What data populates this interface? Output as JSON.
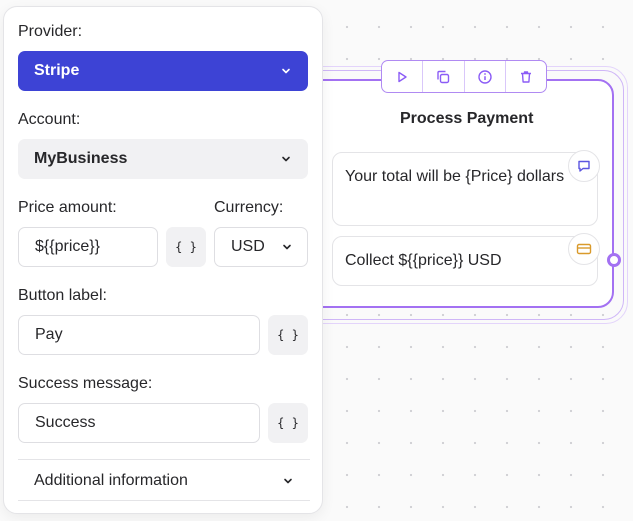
{
  "panel": {
    "provider_label": "Provider:",
    "provider_value": "Stripe",
    "account_label": "Account:",
    "account_value": "MyBusiness",
    "price_label": "Price amount:",
    "price_value": "${{price}}",
    "currency_label": "Currency:",
    "currency_value": "USD",
    "button_label_label": "Button label:",
    "button_label_value": "Pay",
    "success_label": "Success message:",
    "success_value": "Success",
    "variables_button": "{ }",
    "additional_info": "Additional information"
  },
  "node": {
    "title": "Process Payment",
    "text_bubble": "Your total will be {Price} dollars",
    "payment_bubble": "Collect ${{price}} USD",
    "toolbar": [
      "play-icon",
      "duplicate-icon",
      "info-icon",
      "trash-icon"
    ]
  },
  "colors": {
    "primary": "#3d43d5",
    "node_accent": "#a371f2",
    "text_bubble_icon": "#5b55e0",
    "payment_icon": "#d99a2b"
  }
}
